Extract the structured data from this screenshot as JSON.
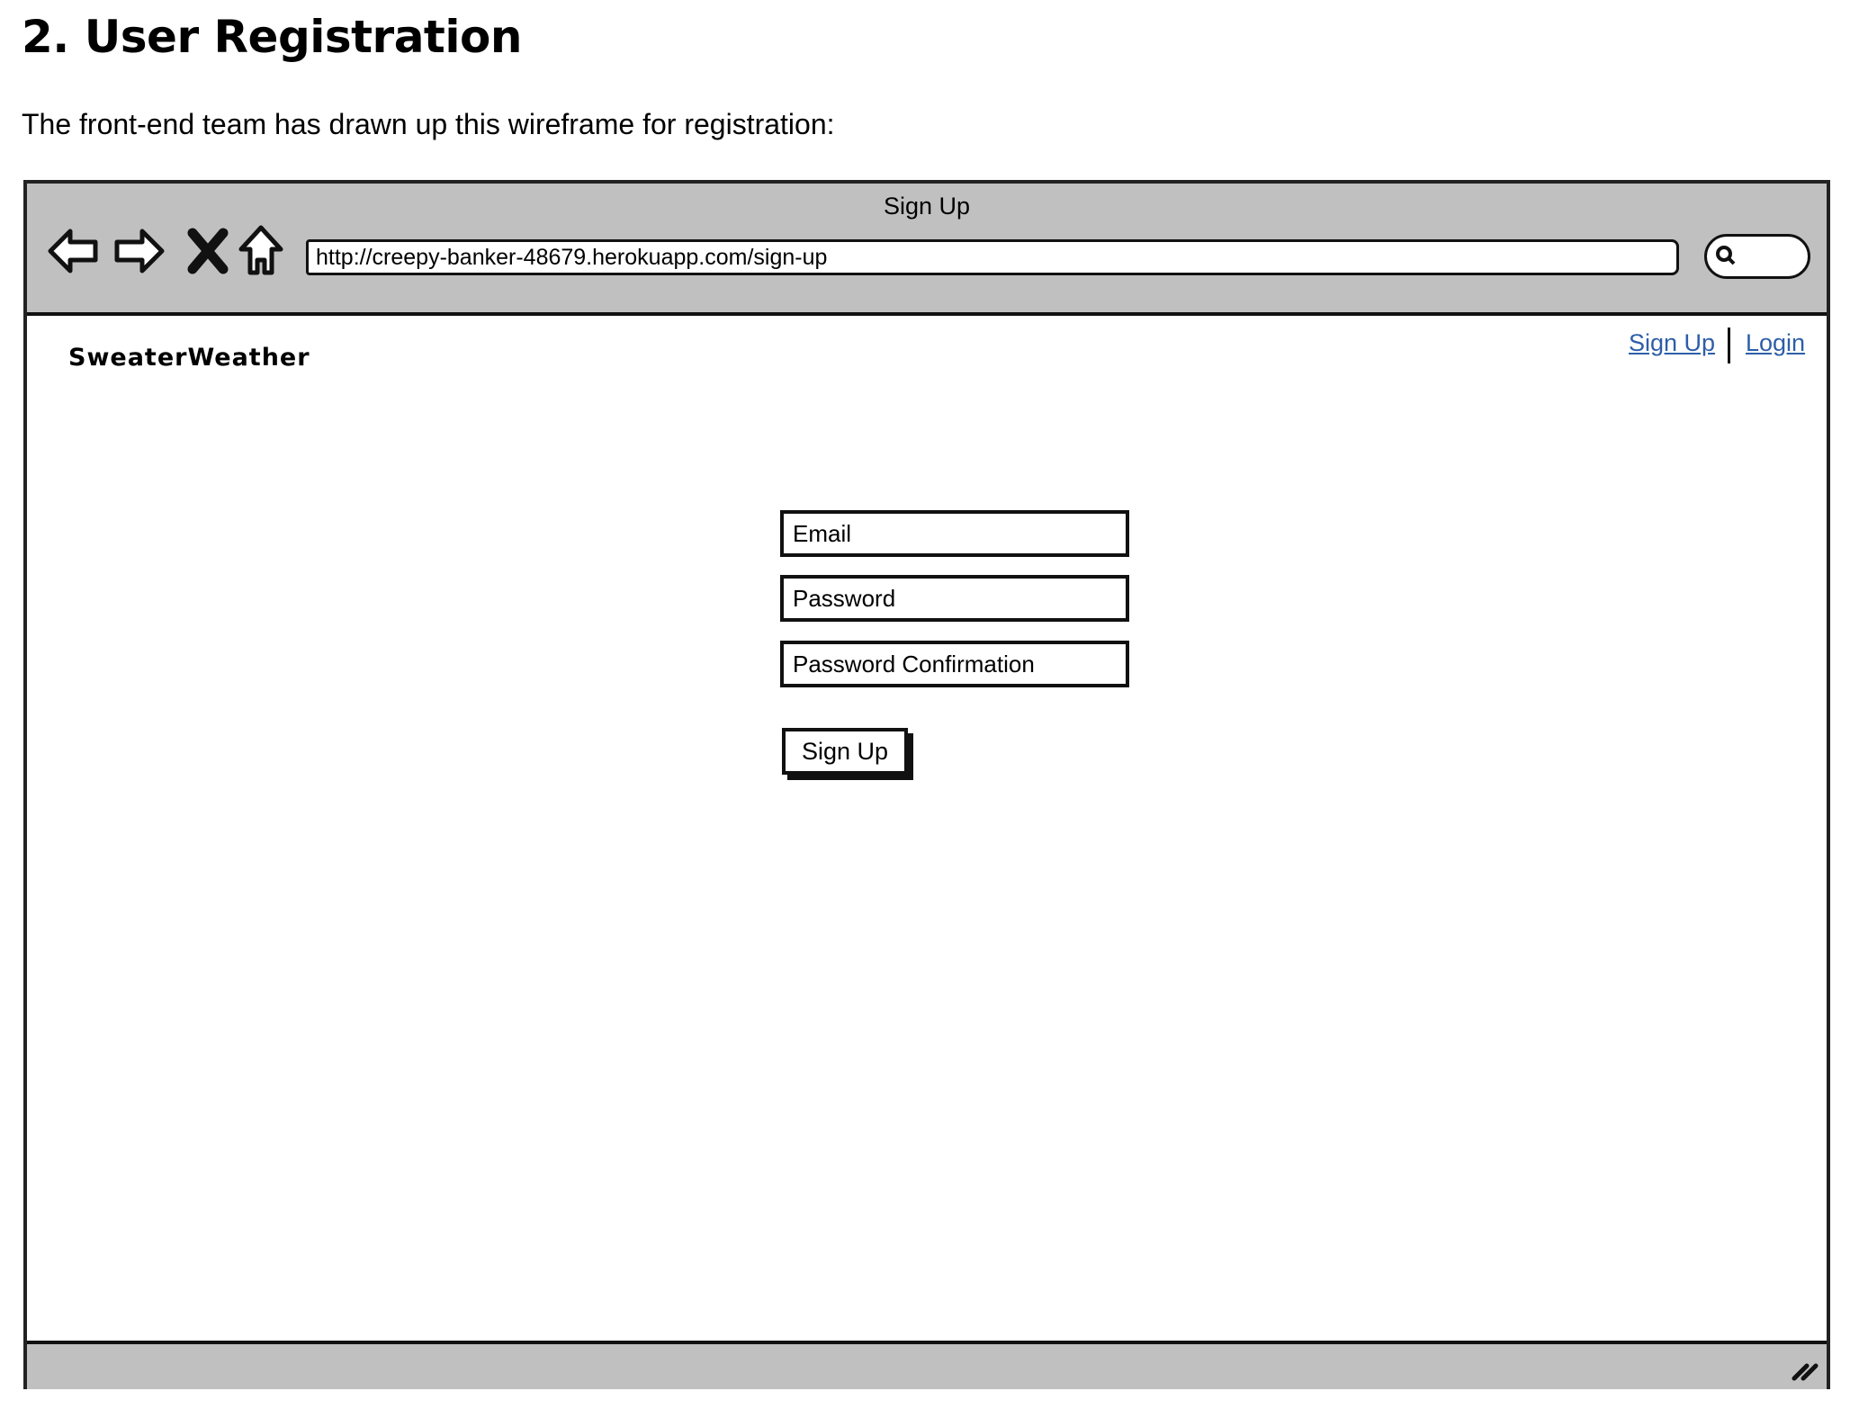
{
  "heading": "2. User Registration",
  "intro": "The front-end team has drawn up this wireframe for registration:",
  "browser": {
    "window_title": "Sign Up",
    "url": "http://creepy-banker-48679.herokuapp.com/sign-up",
    "icons": [
      "back-arrow-icon",
      "forward-arrow-icon",
      "stop-x-icon",
      "home-icon",
      "search-icon",
      "resize-grip-icon"
    ]
  },
  "site": {
    "brand": "SweaterWeather",
    "nav": [
      {
        "label": "Sign Up"
      },
      {
        "label": "Login"
      }
    ],
    "link_color": "#2d5ea8"
  },
  "form": {
    "fields": [
      {
        "placeholder": "Email"
      },
      {
        "placeholder": "Password"
      },
      {
        "placeholder": "Password Confirmation"
      }
    ],
    "submit_label": "Sign Up"
  }
}
